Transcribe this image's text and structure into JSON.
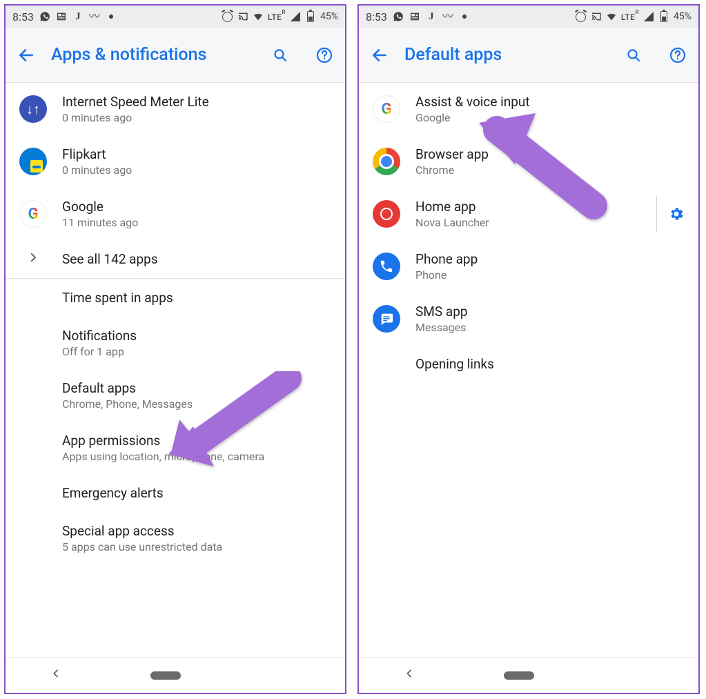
{
  "status": {
    "time": "8:53",
    "lte": "LTE",
    "lte_sup": "R",
    "battery_pct": "45%"
  },
  "left_screen": {
    "header": {
      "title": "Apps & notifications"
    },
    "recent_apps": [
      {
        "name": "Internet Speed Meter Lite",
        "sub": "0 minutes ago",
        "icon": "ism"
      },
      {
        "name": "Flipkart",
        "sub": "0 minutes ago",
        "icon": "flipkart"
      },
      {
        "name": "Google",
        "sub": "11 minutes ago",
        "icon": "google"
      }
    ],
    "see_all": "See all 142 apps",
    "sections": [
      {
        "title": "Time spent in apps",
        "sub": ""
      },
      {
        "title": "Notifications",
        "sub": "Off for 1 app"
      },
      {
        "title": "Default apps",
        "sub": "Chrome, Phone, Messages"
      },
      {
        "title": "App permissions",
        "sub": "Apps using location, microphone, camera"
      },
      {
        "title": "Emergency alerts",
        "sub": ""
      },
      {
        "title": "Special app access",
        "sub": "5 apps can use unrestricted data"
      }
    ]
  },
  "right_screen": {
    "header": {
      "title": "Default apps"
    },
    "items": [
      {
        "title": "Assist & voice input",
        "sub": "Google",
        "icon": "google",
        "gear": false
      },
      {
        "title": "Browser app",
        "sub": "Chrome",
        "icon": "chrome",
        "gear": false
      },
      {
        "title": "Home app",
        "sub": "Nova Launcher",
        "icon": "nova",
        "gear": true
      },
      {
        "title": "Phone app",
        "sub": "Phone",
        "icon": "phone",
        "gear": false
      },
      {
        "title": "SMS app",
        "sub": "Messages",
        "icon": "sms",
        "gear": false
      }
    ],
    "opening_links": "Opening links"
  }
}
